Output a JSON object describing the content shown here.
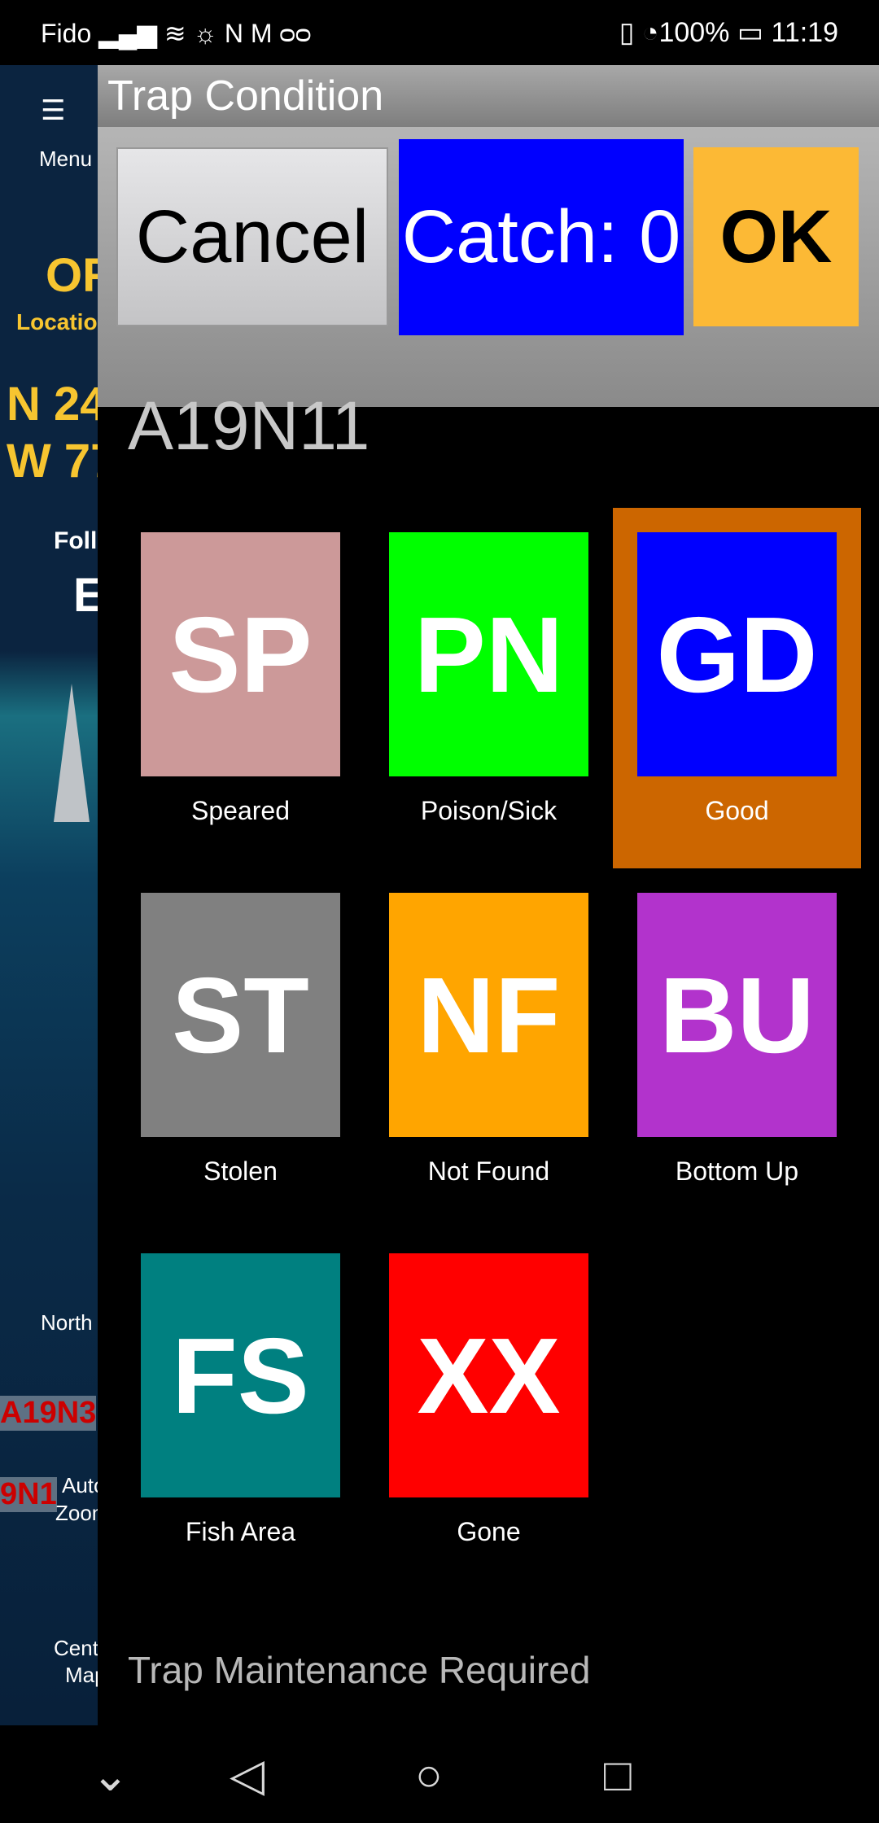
{
  "status_bar": {
    "carrier": "Fido",
    "battery": "100%",
    "time": "11:19",
    "icons": [
      "signal-icon",
      "wifi-icon",
      "eye-icon",
      "nfc-icon",
      "gmail-icon",
      "voicemail-icon",
      "vibrate-icon",
      "speed-icon",
      "battery-icon"
    ]
  },
  "background": {
    "menu_label": "Menu",
    "status_partial": "OF",
    "location_partial": "Locatio",
    "lat_partial": "N 24",
    "lon_partial": "W 77",
    "follow_partial": "Foll",
    "e_partial": "E",
    "north_partial": "North",
    "auto_partial": "Auto",
    "zoom_partial": "Zoom",
    "center_partial": "Cent",
    "map_partial": "Map",
    "trap_label1": "A19N3",
    "trap_label2": "9N1"
  },
  "dialog": {
    "title": "Trap Condition",
    "cancel_label": "Cancel",
    "catch_label": "Catch: 0",
    "ok_label": "OK",
    "trap_id": "A19N11",
    "conditions": [
      {
        "code": "SP",
        "label": "Speared",
        "color": "#cc9999"
      },
      {
        "code": "PN",
        "label": "Poison/Sick",
        "color": "#00ff00"
      },
      {
        "code": "GD",
        "label": "Good",
        "color": "#0000ff",
        "selected": true
      },
      {
        "code": "ST",
        "label": "Stolen",
        "color": "#808080"
      },
      {
        "code": "NF",
        "label": "Not Found",
        "color": "#ffa500"
      },
      {
        "code": "BU",
        "label": "Bottom Up",
        "color": "#b233cc"
      },
      {
        "code": "FS",
        "label": "Fish Area",
        "color": "#008080"
      },
      {
        "code": "XX",
        "label": "Gone",
        "color": "#ff0000"
      }
    ],
    "selected_highlight": "#cc6600",
    "maintenance_label": "Trap Maintenance Required"
  },
  "nav": {
    "icons": [
      "collapse-icon",
      "back-icon",
      "home-icon",
      "recents-icon"
    ]
  }
}
